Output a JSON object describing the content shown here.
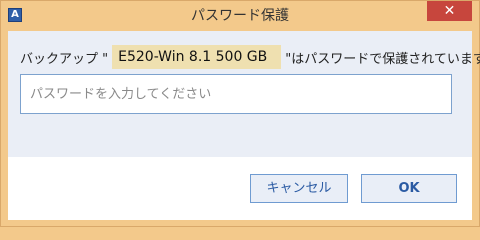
{
  "window": {
    "title": "パスワード保護",
    "app_icon_glyph": "A",
    "close_glyph": "✕"
  },
  "message": {
    "prefix": "バックアップ \"",
    "backup_name": "E520-Win 8.1 500 GB",
    "suffix": "\"はパスワードで保護されています。"
  },
  "password": {
    "value": "",
    "placeholder": "パスワードを入力してください"
  },
  "buttons": {
    "cancel": "キャンセル",
    "ok": "OK"
  },
  "colors": {
    "title_bar": "#f3c98b",
    "close_button": "#c7463d",
    "upper_panel": "#eaeef6",
    "accent": "#2a5aa3"
  }
}
